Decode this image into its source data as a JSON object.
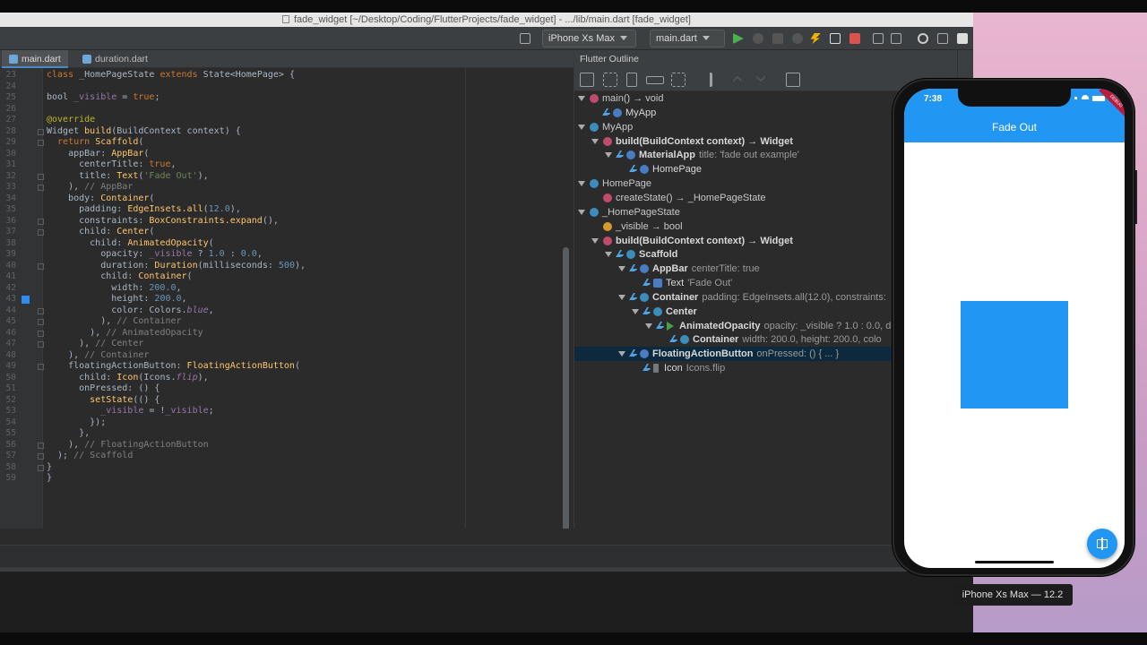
{
  "window_title": "fade_widget [~/Desktop/Coding/FlutterProjects/fade_widget] - .../lib/main.dart [fade_widget]",
  "toolbar": {
    "device_selector": "iPhone Xs Max",
    "run_config": "main.dart"
  },
  "tabs": [
    {
      "label": "main.dart",
      "active": true
    },
    {
      "label": "duration.dart",
      "active": false
    }
  ],
  "editor": {
    "line_numbers": [
      "23",
      "24",
      "25",
      "26",
      "27",
      "28",
      "29",
      "30",
      "31",
      "32",
      "33",
      "34",
      "35",
      "36",
      "37",
      "38",
      "39",
      "40",
      "41",
      "42",
      "43",
      "44",
      "45",
      "46",
      "47",
      "48",
      "49",
      "50",
      "51",
      "52",
      "53",
      "54",
      "55",
      "56",
      "57",
      "58",
      "59"
    ],
    "lines": [
      [
        {
          "t": "class ",
          "c": "kw"
        },
        {
          "t": "_HomePageState ",
          "c": ""
        },
        {
          "t": "extends ",
          "c": "kw"
        },
        {
          "t": "State<HomePage> {",
          "c": ""
        }
      ],
      [],
      [
        {
          "t": "bool ",
          "c": ""
        },
        {
          "t": "_visible",
          "c": "field"
        },
        {
          "t": " = ",
          "c": ""
        },
        {
          "t": "true",
          "c": "kw"
        },
        {
          "t": ";",
          "c": ""
        }
      ],
      [],
      [
        {
          "t": "@override",
          "c": "an"
        }
      ],
      [
        {
          "t": "Widget ",
          "c": ""
        },
        {
          "t": "build",
          "c": "fn"
        },
        {
          "t": "(BuildContext context) {",
          "c": ""
        }
      ],
      [
        {
          "t": "  return ",
          "c": "kw"
        },
        {
          "t": "Scaffold",
          "c": "fn"
        },
        {
          "t": "(",
          "c": ""
        }
      ],
      [
        {
          "t": "    appBar: ",
          "c": ""
        },
        {
          "t": "AppBar",
          "c": "fn"
        },
        {
          "t": "(",
          "c": ""
        }
      ],
      [
        {
          "t": "      centerTitle: ",
          "c": ""
        },
        {
          "t": "true",
          "c": "kw"
        },
        {
          "t": ",",
          "c": ""
        }
      ],
      [
        {
          "t": "      title: ",
          "c": ""
        },
        {
          "t": "Text",
          "c": "fn"
        },
        {
          "t": "(",
          "c": ""
        },
        {
          "t": "'Fade Out'",
          "c": "str"
        },
        {
          "t": "),",
          "c": ""
        }
      ],
      [
        {
          "t": "    ), ",
          "c": ""
        },
        {
          "t": "// AppBar",
          "c": "cm"
        }
      ],
      [
        {
          "t": "    body: ",
          "c": ""
        },
        {
          "t": "Container",
          "c": "fn"
        },
        {
          "t": "(",
          "c": ""
        }
      ],
      [
        {
          "t": "      padding: ",
          "c": ""
        },
        {
          "t": "EdgeInsets.all",
          "c": "fn"
        },
        {
          "t": "(",
          "c": ""
        },
        {
          "t": "12.0",
          "c": "num"
        },
        {
          "t": "),",
          "c": ""
        }
      ],
      [
        {
          "t": "      constraints: ",
          "c": ""
        },
        {
          "t": "BoxConstraints.expand",
          "c": "fn"
        },
        {
          "t": "(),",
          "c": ""
        }
      ],
      [
        {
          "t": "      child: ",
          "c": ""
        },
        {
          "t": "Center",
          "c": "fn"
        },
        {
          "t": "(",
          "c": ""
        }
      ],
      [
        {
          "t": "        child: ",
          "c": ""
        },
        {
          "t": "AnimatedOpacity",
          "c": "fn"
        },
        {
          "t": "(",
          "c": ""
        }
      ],
      [
        {
          "t": "          opacity: ",
          "c": ""
        },
        {
          "t": "_visible",
          "c": "field"
        },
        {
          "t": " ? ",
          "c": ""
        },
        {
          "t": "1.0",
          "c": "num"
        },
        {
          "t": " : ",
          "c": ""
        },
        {
          "t": "0.0",
          "c": "num"
        },
        {
          "t": ",",
          "c": ""
        }
      ],
      [
        {
          "t": "          duration: ",
          "c": ""
        },
        {
          "t": "Duration",
          "c": "fn"
        },
        {
          "t": "(milliseconds: ",
          "c": ""
        },
        {
          "t": "500",
          "c": "num"
        },
        {
          "t": "),",
          "c": ""
        }
      ],
      [
        {
          "t": "          child: ",
          "c": ""
        },
        {
          "t": "Container",
          "c": "fn"
        },
        {
          "t": "(",
          "c": ""
        }
      ],
      [
        {
          "t": "            width: ",
          "c": ""
        },
        {
          "t": "200.0",
          "c": "num"
        },
        {
          "t": ",",
          "c": ""
        }
      ],
      [
        {
          "t": "            height: ",
          "c": ""
        },
        {
          "t": "200.0",
          "c": "num"
        },
        {
          "t": ",",
          "c": ""
        }
      ],
      [
        {
          "t": "            color: Colors.",
          "c": ""
        },
        {
          "t": "blue",
          "c": "ital"
        },
        {
          "t": ",",
          "c": ""
        }
      ],
      [
        {
          "t": "          ), ",
          "c": ""
        },
        {
          "t": "// Container",
          "c": "cm"
        }
      ],
      [
        {
          "t": "        ), ",
          "c": ""
        },
        {
          "t": "// AnimatedOpacity",
          "c": "cm"
        }
      ],
      [
        {
          "t": "      ), ",
          "c": ""
        },
        {
          "t": "// Center",
          "c": "cm"
        }
      ],
      [
        {
          "t": "    ), ",
          "c": ""
        },
        {
          "t": "// Container",
          "c": "cm"
        }
      ],
      [
        {
          "t": "    floatingActionButton: ",
          "c": ""
        },
        {
          "t": "FloatingActionButton",
          "c": "fn"
        },
        {
          "t": "(",
          "c": ""
        }
      ],
      [
        {
          "t": "      child: ",
          "c": ""
        },
        {
          "t": "Icon",
          "c": "fn"
        },
        {
          "t": "(Icons.",
          "c": ""
        },
        {
          "t": "flip",
          "c": "ital"
        },
        {
          "t": "),",
          "c": ""
        }
      ],
      [
        {
          "t": "      onPressed: () {",
          "c": ""
        }
      ],
      [
        {
          "t": "        setState",
          "c": "fn"
        },
        {
          "t": "(() {",
          "c": ""
        }
      ],
      [
        {
          "t": "          _visible",
          "c": "field"
        },
        {
          "t": " = !",
          "c": ""
        },
        {
          "t": "_visible",
          "c": "field"
        },
        {
          "t": ";",
          "c": ""
        }
      ],
      [
        {
          "t": "        });",
          "c": ""
        }
      ],
      [
        {
          "t": "      },",
          "c": ""
        }
      ],
      [
        {
          "t": "    ), ",
          "c": ""
        },
        {
          "t": "// FloatingActionButton",
          "c": "cm"
        }
      ],
      [
        {
          "t": "  ); ",
          "c": ""
        },
        {
          "t": "// Scaffold",
          "c": "cm"
        }
      ],
      [
        {
          "t": "}",
          "c": ""
        }
      ],
      [
        {
          "t": "}",
          "c": ""
        }
      ]
    ]
  },
  "outline": {
    "title": "Flutter Outline",
    "rows": [
      {
        "depth": 0,
        "tri": true,
        "icon": "m",
        "bold": false,
        "name": "main() → void",
        "extra": ""
      },
      {
        "depth": 1,
        "tri": false,
        "icon": "w",
        "flutter": true,
        "name": "MyApp",
        "extra": ""
      },
      {
        "depth": 0,
        "tri": true,
        "icon": "c",
        "name": "MyApp",
        "extra": ""
      },
      {
        "depth": 1,
        "tri": true,
        "icon": "m",
        "bold": true,
        "name": "build(BuildContext context) → Widget",
        "extra": ""
      },
      {
        "depth": 2,
        "tri": true,
        "icon": "w",
        "flutter": true,
        "name": "MaterialApp",
        "extra": "title: 'fade out example'"
      },
      {
        "depth": 3,
        "tri": false,
        "icon": "w",
        "flutter": true,
        "name": "HomePage",
        "extra": ""
      },
      {
        "depth": 0,
        "tri": true,
        "icon": "c",
        "name": "HomePage",
        "extra": ""
      },
      {
        "depth": 1,
        "tri": false,
        "icon": "m",
        "name": "createState() → _HomePageState",
        "extra": ""
      },
      {
        "depth": 0,
        "tri": true,
        "icon": "c",
        "name": "_HomePageState",
        "extra": ""
      },
      {
        "depth": 1,
        "tri": false,
        "icon": "f",
        "name": "_visible → bool",
        "extra": ""
      },
      {
        "depth": 1,
        "tri": true,
        "icon": "m",
        "bold": true,
        "name": "build(BuildContext context) → Widget",
        "extra": ""
      },
      {
        "depth": 2,
        "tri": true,
        "icon": "c",
        "flutter": true,
        "name": "Scaffold",
        "extra": ""
      },
      {
        "depth": 3,
        "tri": true,
        "icon": "w",
        "flutter": true,
        "name": "AppBar",
        "extra": "centerTitle: true"
      },
      {
        "depth": 4,
        "tri": false,
        "icon": "t",
        "flutter": true,
        "name": "Text",
        "extra": "'Fade Out'"
      },
      {
        "depth": 3,
        "tri": true,
        "icon": "c",
        "flutter": true,
        "name": "Container",
        "extra": "padding: EdgeInsets.all(12.0), constraints:"
      },
      {
        "depth": 4,
        "tri": true,
        "icon": "c",
        "flutter": true,
        "name": "Center",
        "extra": ""
      },
      {
        "depth": 5,
        "tri": true,
        "icon": "play",
        "flutter": true,
        "name": "AnimatedOpacity",
        "extra": "opacity: _visible ? 1.0 : 0.0, d"
      },
      {
        "depth": 6,
        "tri": false,
        "icon": "c",
        "flutter": true,
        "name": "Container",
        "extra": "width: 200.0, height: 200.0, colo"
      },
      {
        "depth": 3,
        "tri": true,
        "icon": "w",
        "flutter": true,
        "name": "FloatingActionButton",
        "extra": "onPressed: () { ... }",
        "selected": true
      },
      {
        "depth": 4,
        "tri": false,
        "icon": "none",
        "flutter": true,
        "name": "Icon",
        "extra": "Icons.flip"
      }
    ]
  },
  "phone": {
    "time": "7:38",
    "app_title": "Fade Out",
    "debug_banner": "DEBUG",
    "device_label": "iPhone Xs Max — 12.2",
    "box_color": "#2196F3",
    "fab_icon": "flip-icon"
  },
  "colors": {
    "flutter_blue": "#2196F3",
    "ide_bg": "#2B2B2B",
    "selection": "#0D293E"
  }
}
